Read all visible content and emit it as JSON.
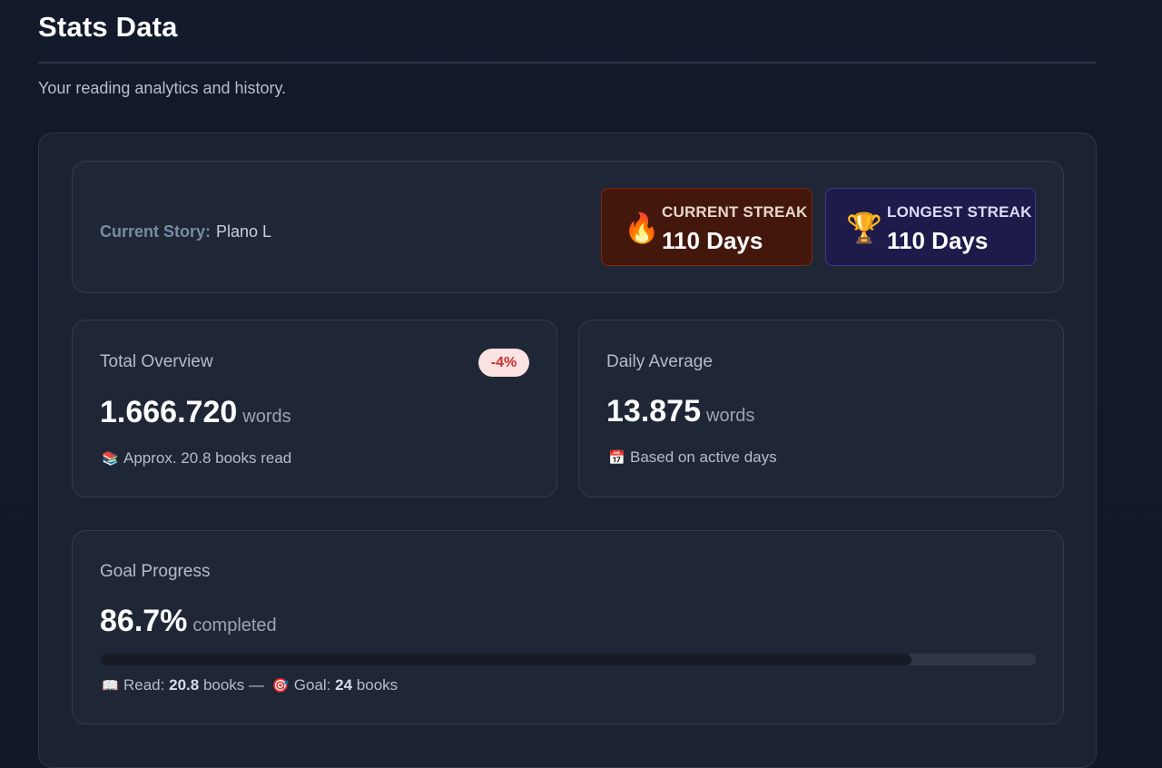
{
  "page": {
    "title": "Stats Data",
    "subtitle": "Your reading analytics and history."
  },
  "story": {
    "label": "Current Story:",
    "value": "Plano L"
  },
  "streaks": {
    "current": {
      "label": "CURRENT STREAK",
      "value": "110 Days",
      "icon": "flame-icon"
    },
    "longest": {
      "label": "LONGEST STREAK",
      "value": "110 Days",
      "icon": "trophy-icon"
    }
  },
  "total_overview": {
    "label": "Total Overview",
    "badge": "-4%",
    "value": "1.666.720",
    "unit": "words",
    "note": "Approx. 20.8 books read",
    "note_icon": "books-icon"
  },
  "daily_average": {
    "label": "Daily Average",
    "value": "13.875",
    "unit": "words",
    "note": "Based on active days",
    "note_icon": "calendar-icon"
  },
  "goal": {
    "label": "Goal Progress",
    "value": "86.7%",
    "unit": "completed",
    "progress": 0.867,
    "read_label": "Read:",
    "read_value": "20.8",
    "read_unit": "books —",
    "goal_label": "Goal:",
    "goal_value": "24",
    "goal_unit": "books",
    "read_icon": "open-book-icon",
    "goal_icon": "target-icon"
  },
  "colors": {
    "background": "#111827",
    "card": "#1f2737",
    "current_streak_bg": "#44170d",
    "longest_streak_bg": "#1e1b4b",
    "badge_bg": "#fde2e2",
    "badge_text": "#c53030"
  }
}
